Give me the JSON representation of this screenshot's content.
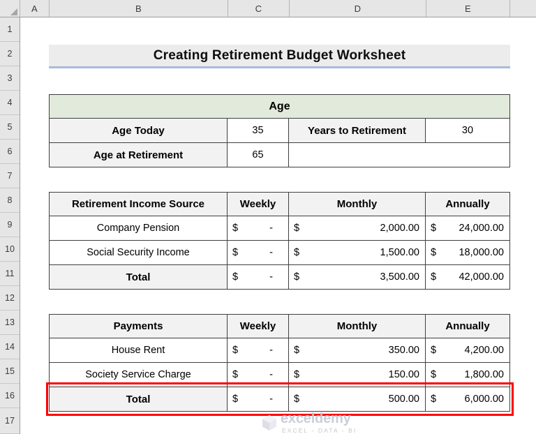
{
  "spreadsheet": {
    "column_headers": [
      "A",
      "B",
      "C",
      "D",
      "E"
    ],
    "row_headers": [
      "1",
      "2",
      "3",
      "4",
      "5",
      "6",
      "7",
      "8",
      "9",
      "10",
      "11",
      "12",
      "13",
      "14",
      "15",
      "16",
      "17"
    ],
    "select_all_icon": "select-all-corner"
  },
  "banner": {
    "title": "Creating Retirement Budget Worksheet"
  },
  "age_table": {
    "header": "Age",
    "rows": [
      {
        "label": "Age Today",
        "value": "35",
        "label2": "Years to Retirement",
        "value2": "30"
      },
      {
        "label": "Age at Retirement",
        "value": "65",
        "label2": "",
        "value2": ""
      }
    ]
  },
  "income_table": {
    "columns": [
      "Retirement Income Source",
      "Weekly",
      "Monthly",
      "Annually"
    ],
    "rows": [
      {
        "source": "Company Pension",
        "weekly_symbol": "$",
        "weekly_amount": "-",
        "monthly_symbol": "$",
        "monthly_amount": "2,000.00",
        "annual_symbol": "$",
        "annual_amount": "24,000.00"
      },
      {
        "source": "Social Security Income",
        "weekly_symbol": "$",
        "weekly_amount": "-",
        "monthly_symbol": "$",
        "monthly_amount": "1,500.00",
        "annual_symbol": "$",
        "annual_amount": "18,000.00"
      },
      {
        "source": "Total",
        "weekly_symbol": "$",
        "weekly_amount": "-",
        "monthly_symbol": "$",
        "monthly_amount": "3,500.00",
        "annual_symbol": "$",
        "annual_amount": "42,000.00"
      }
    ]
  },
  "payments_table": {
    "columns": [
      "Payments",
      "Weekly",
      "Monthly",
      "Annually"
    ],
    "rows": [
      {
        "source": "House Rent",
        "weekly_symbol": "$",
        "weekly_amount": "-",
        "monthly_symbol": "$",
        "monthly_amount": "350.00",
        "annual_symbol": "$",
        "annual_amount": "4,200.00"
      },
      {
        "source": "Society Service Charge",
        "weekly_symbol": "$",
        "weekly_amount": "-",
        "monthly_symbol": "$",
        "monthly_amount": "150.00",
        "annual_symbol": "$",
        "annual_amount": "1,800.00"
      },
      {
        "source": "Total",
        "weekly_symbol": "$",
        "weekly_amount": "-",
        "monthly_symbol": "$",
        "monthly_amount": "500.00",
        "annual_symbol": "$",
        "annual_amount": "6,000.00"
      }
    ]
  },
  "highlight": {
    "color": "#ff0000",
    "target_row": "16"
  },
  "watermark": {
    "name": "exceldemy",
    "tagline": "EXCEL - DATA - BI"
  },
  "colors": {
    "header_fill": "#f2f2f2",
    "age_header_fill": "#e2ebdb",
    "banner_fill": "#ececec",
    "banner_underline": "#a8bcdc",
    "grid_border": "#3f3f3f",
    "highlight": "#ff0000"
  }
}
